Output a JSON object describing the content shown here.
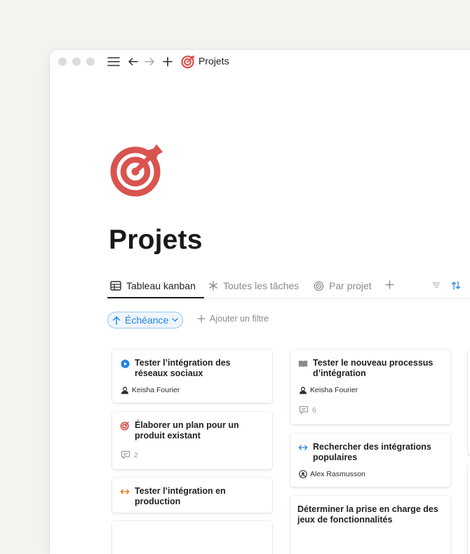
{
  "window": {
    "title": "Projets"
  },
  "page": {
    "title": "Projets",
    "icon": "target-icon"
  },
  "tabs": [
    {
      "label": "Tableau kanban",
      "icon": "table-icon",
      "active": true
    },
    {
      "label": "Toutes les tâches",
      "icon": "asterisk-icon",
      "active": false
    },
    {
      "label": "Par projet",
      "icon": "target-circle-icon",
      "active": false
    }
  ],
  "filters": {
    "active_chip": "Échéance",
    "add_label": "Ajouter un filtre"
  },
  "columns": [
    {
      "cards": [
        {
          "title": "Tester l’intégration des réseaux sociaux",
          "icon": "play-icon",
          "person": "Keisha Fourier"
        },
        {
          "title": "Élaborer un plan pour un produit existant",
          "icon": "target-icon",
          "comments": "2"
        },
        {
          "title": "Tester l’intégration en production",
          "icon": "arrows-horizontal-icon"
        }
      ]
    },
    {
      "cards": [
        {
          "title": "Tester le nouveau processus d’intégration",
          "icon": "book-icon",
          "person": "Keisha Fourier",
          "comments": "6"
        },
        {
          "title": "Rechercher des intégrations populaires",
          "icon": "arrows-horizontal-icon",
          "person": "Alex Rasmusson"
        },
        {
          "title": "Déterminer la prise en charge des jeux de fonctionnalités"
        }
      ]
    }
  ],
  "colors": {
    "accent": "#2383e2",
    "target_red": "#d9534f",
    "orange": "#d9730d"
  }
}
